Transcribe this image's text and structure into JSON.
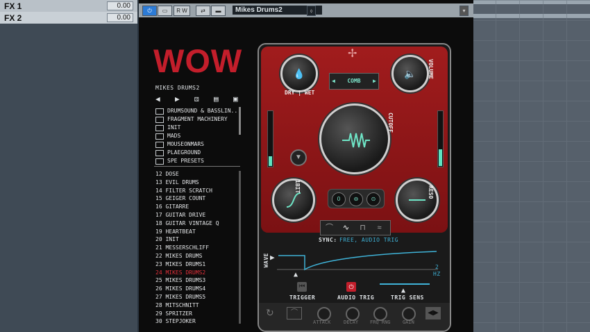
{
  "mixer": {
    "rows": [
      {
        "label": "FX 1",
        "value": "0.00"
      },
      {
        "label": "FX 2",
        "value": "0.00"
      }
    ]
  },
  "plugin": {
    "preset_name": "Mikes Drums2",
    "toolbar": {
      "rw": "R W"
    },
    "logo": "WOW",
    "browser": {
      "title": "MIKES DRUMS2",
      "folders": [
        "DRUMSOUND & BASSLIN..",
        "FRAGMENT MACHINERY",
        "INIT",
        "MADS",
        "MOUSEONMARS",
        "PLAEGROUND",
        "SPE PRESETS"
      ],
      "presets": [
        "12 DOSE",
        "13 EVIL DRUMS",
        "14 FILTER SCRATCH",
        "15 GEIGER COUNT",
        "16 GITARRE",
        "17 GUITAR DRIVE",
        "18 GUITAR VINTAGE Q",
        "19 HEARTBEAT",
        "20 INIT",
        "21 MESSERSCHLIFF",
        "22 MIKES DRUMS",
        "23 MIKES DRUMS1",
        "24 MIKES DRUMS2",
        "25 MIKES DRUMS3",
        "26 MIKES DRUMS4",
        "27 MIKES DRUMS5",
        "28 MITSCHNITT",
        "29 SPRITZER",
        "30 STEPJOKER"
      ],
      "selected_index": 12,
      "selected_color": "#e0303a"
    },
    "knobs": {
      "drywet": "DRY | WET",
      "volume": "VOLUME",
      "cutoff": "CUTOFF",
      "bit": "1BIT",
      "reso": "RESO"
    },
    "filter_type": "COMB",
    "filter_buttons": [
      "0",
      "",
      ""
    ],
    "sync": {
      "label": "SYNC:",
      "value": "FREE, AUDIO TRIG"
    },
    "wave_label": "WAVE",
    "rate": {
      "value": "2",
      "unit": "HZ"
    },
    "trigger_labels": {
      "trigger": "TRIGGER",
      "audio_trig": "AUDIO TRIG",
      "trig_sens": "TRIG SENS"
    },
    "env_labels": [
      "ATTACK",
      "DECAY",
      "FRQ RNG",
      "GAIN"
    ],
    "colors": {
      "accent": "#5fe3bf",
      "brand_red": "#c31e2b",
      "sync_value": "#3fb3d8"
    }
  }
}
